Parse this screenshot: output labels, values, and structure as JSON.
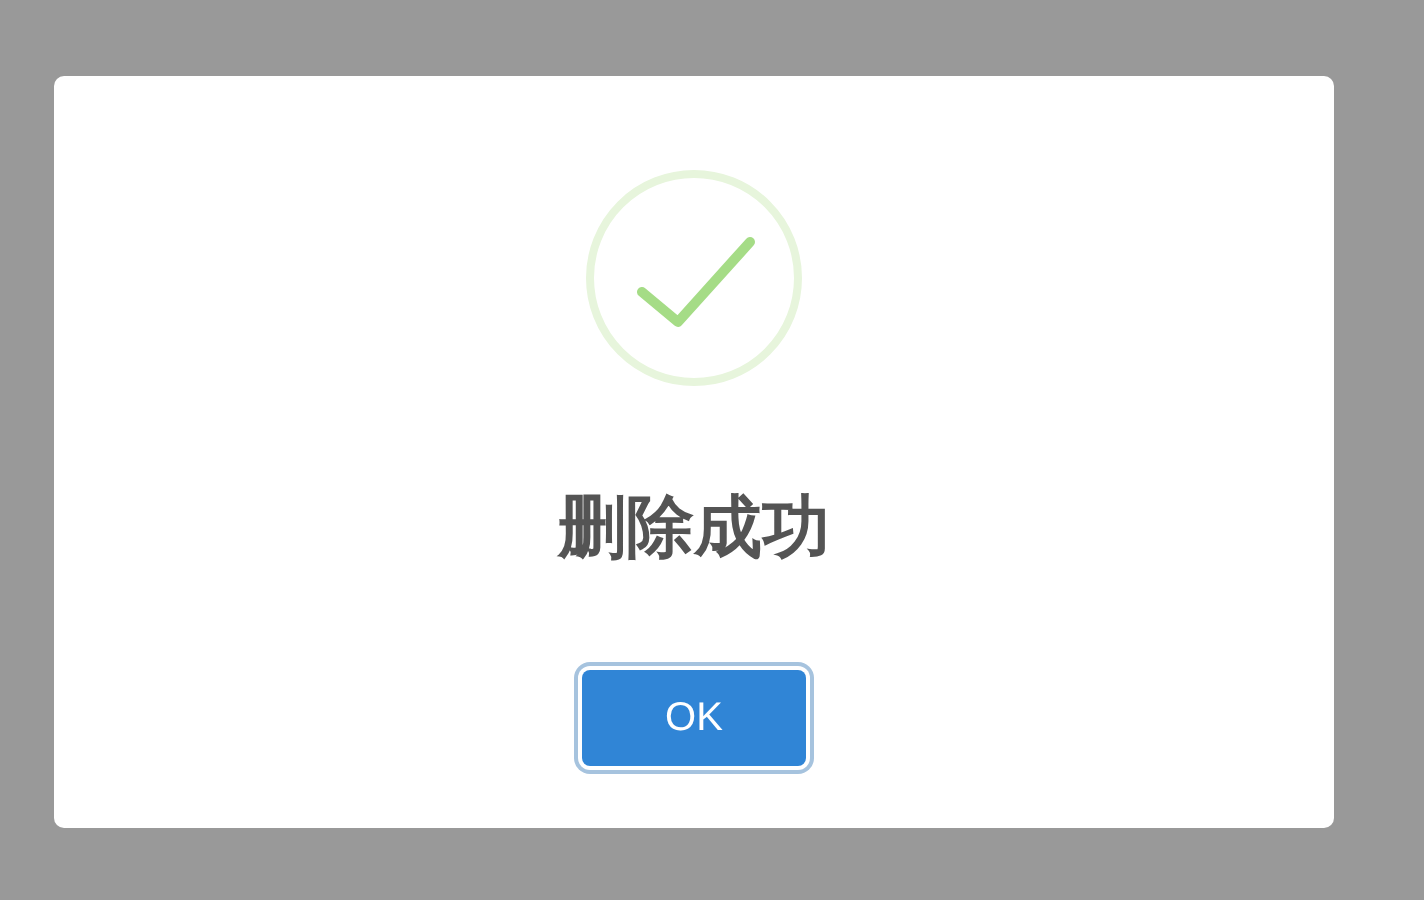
{
  "dialog": {
    "kind": "success",
    "title": "删除成功",
    "confirm_button": "OK"
  }
}
